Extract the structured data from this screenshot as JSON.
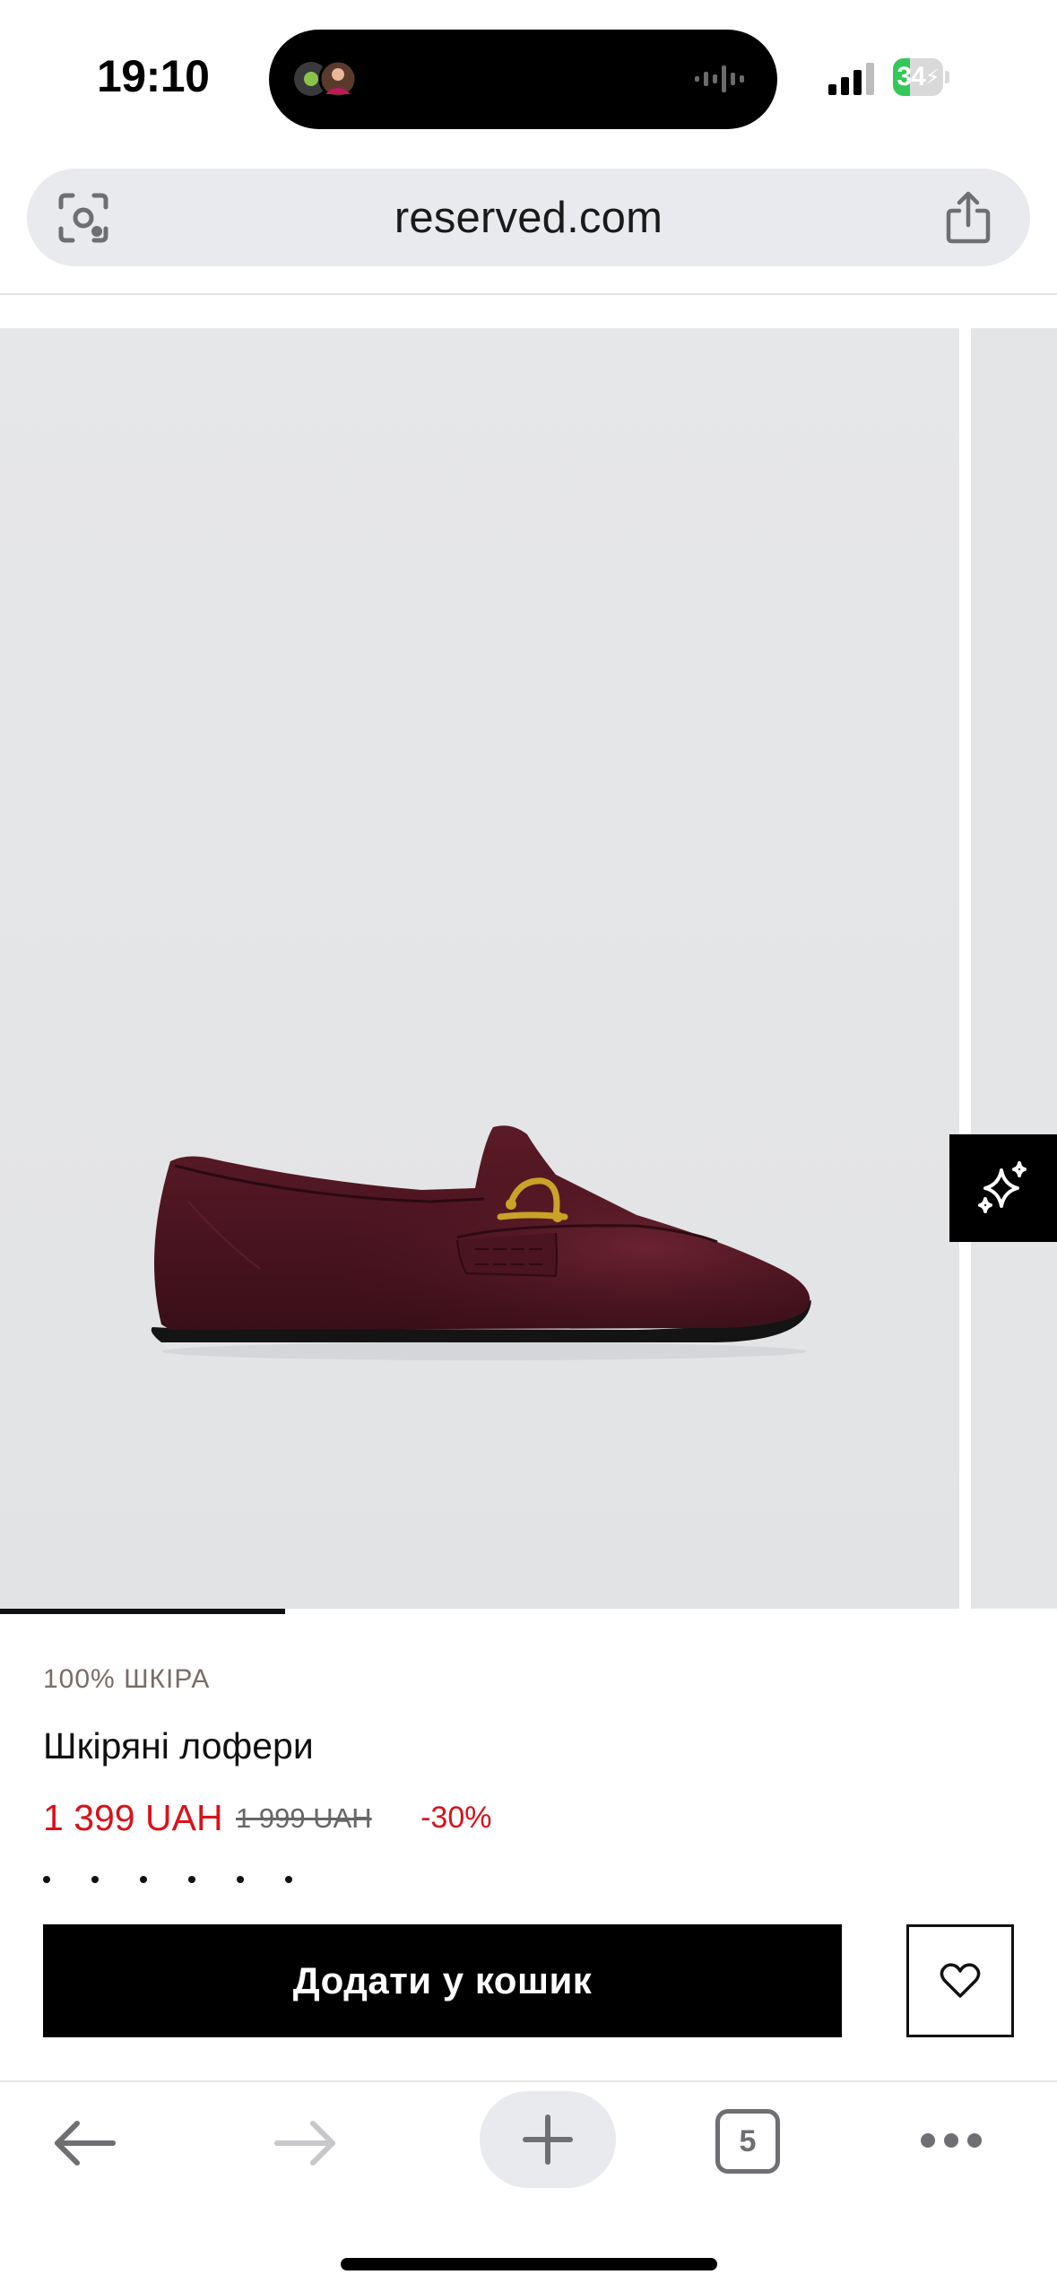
{
  "status_bar": {
    "time": "19:10",
    "battery_level": "34",
    "battery_fraction": 0.34,
    "island_icons": [
      "notification-avatars-icon",
      "audio-waveform-icon"
    ],
    "signal_icon": "cellular-signal-icon"
  },
  "browser": {
    "url": "reserved.com",
    "lens_icon": "camera-scan-icon",
    "share_icon": "share-icon",
    "tab_count": "5",
    "nav_icons": [
      "back-arrow-icon",
      "forward-arrow-icon",
      "plus-icon",
      "tabs-icon",
      "more-icon"
    ]
  },
  "gallery": {
    "image_subject": "burgundy leather loafer with gold horsebit",
    "progress_fraction": 0.27,
    "ai_button_icon": "sparkles-icon"
  },
  "product": {
    "badge": "100% ШКІРА",
    "name": "Шкіряні лофери",
    "price_current": "1 399 UAH",
    "price_old": "1 999 UAH",
    "discount": "-30%",
    "add_to_cart_label": "Додати у кошик",
    "wishlist_icon": "heart-icon"
  },
  "colors": {
    "brand_black": "#000000",
    "sale_red": "#d8121b",
    "badge_brown": "#7a6c68",
    "battery_green": "#34c759"
  }
}
